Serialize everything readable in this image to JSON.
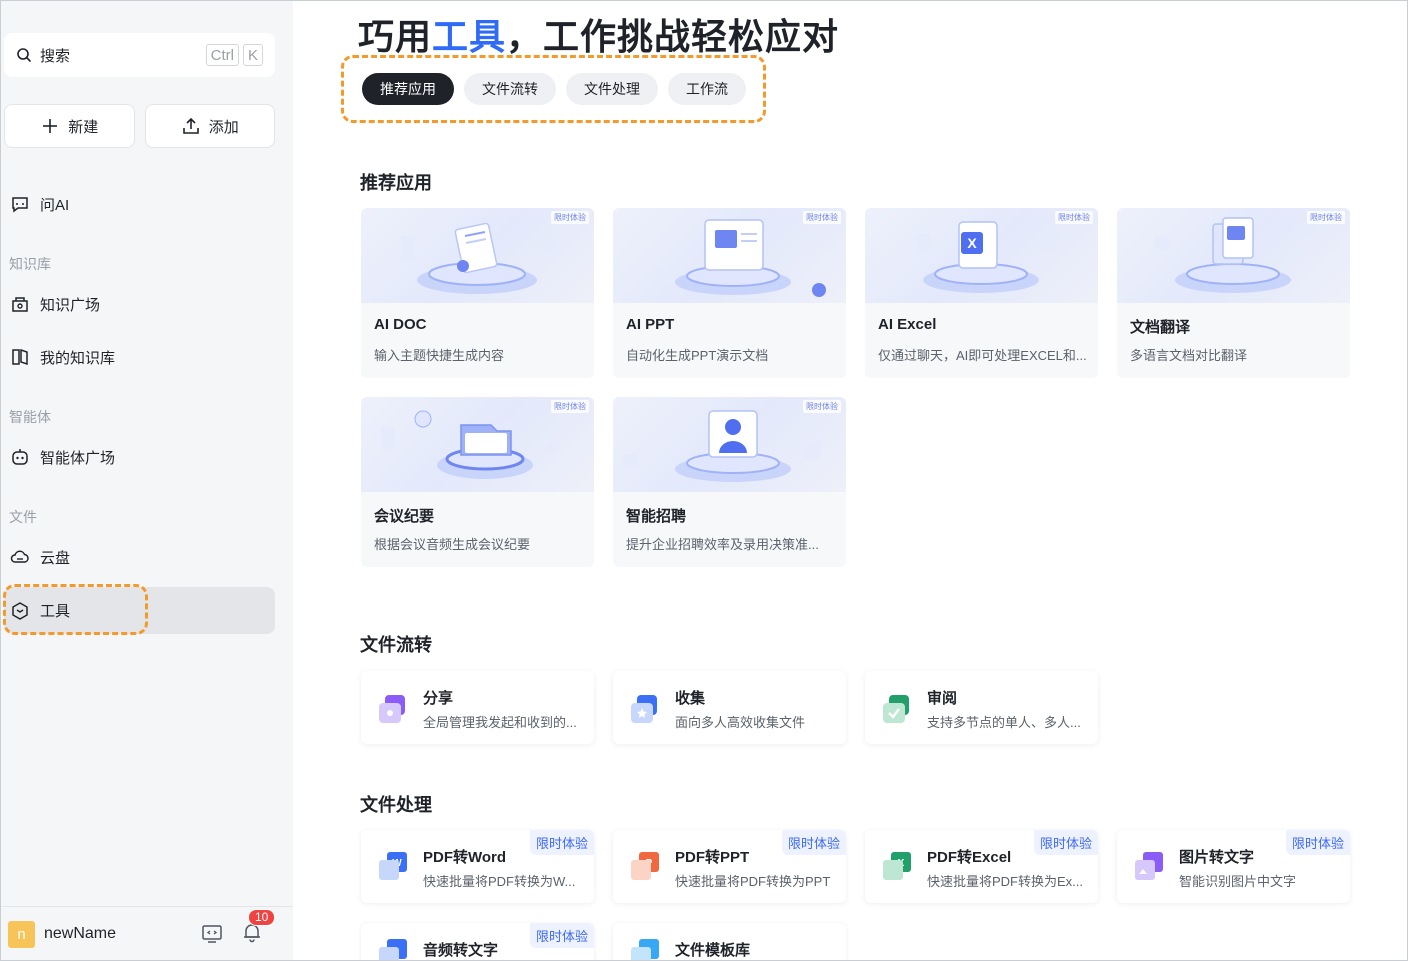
{
  "sidebar": {
    "search": {
      "label": "搜索",
      "shortcut_mod": "Ctrl",
      "shortcut_key": "K"
    },
    "new_label": "新建",
    "add_label": "添加",
    "ask_ai": "问AI",
    "sections": {
      "knowledge": "知识库",
      "agents": "智能体",
      "files": "文件"
    },
    "items": {
      "knowledge_square": "知识广场",
      "my_knowledge": "我的知识库",
      "agent_square": "智能体广场",
      "cloud": "云盘",
      "tools": "工具"
    },
    "user": {
      "avatar_initial": "n",
      "name": "newName",
      "notification_count": "10"
    }
  },
  "main": {
    "headline": {
      "part1": "巧用",
      "highlight": "工具",
      "part2": "，工作挑战轻松应对"
    },
    "tabs": [
      "推荐应用",
      "文件流转",
      "文件处理",
      "工作流"
    ],
    "recommended": {
      "title": "推荐应用",
      "thumb_tag": "限时体验",
      "cards": [
        {
          "title": "AI DOC",
          "desc": "输入主题快捷生成内容"
        },
        {
          "title": "AI PPT",
          "desc": "自动化生成PPT演示文档"
        },
        {
          "title": "AI Excel",
          "desc": "仅通过聊天，AI即可处理EXCEL和..."
        },
        {
          "title": "文档翻译",
          "desc": "多语言文档对比翻译"
        },
        {
          "title": "会议纪要",
          "desc": "根据会议音频生成会议纪要"
        },
        {
          "title": "智能招聘",
          "desc": "提升企业招聘效率及录用决策准..."
        }
      ]
    },
    "flow": {
      "title": "文件流转",
      "cards": [
        {
          "title": "分享",
          "desc": "全局管理我发起和收到的..."
        },
        {
          "title": "收集",
          "desc": "面向多人高效收集文件"
        },
        {
          "title": "审阅",
          "desc": "支持多节点的单人、多人..."
        }
      ]
    },
    "processing": {
      "title": "文件处理",
      "limited_tag": "限时体验",
      "cards": [
        {
          "title": "PDF转Word",
          "desc": "快速批量将PDF转换为W..."
        },
        {
          "title": "PDF转PPT",
          "desc": "快速批量将PDF转换为PPT"
        },
        {
          "title": "PDF转Excel",
          "desc": "快速批量将PDF转换为Ex..."
        },
        {
          "title": "图片转文字",
          "desc": "智能识别图片中文字"
        },
        {
          "title": "音频转文字",
          "desc": ""
        },
        {
          "title": "文件模板库",
          "desc": ""
        }
      ]
    }
  },
  "colors": {
    "accent": "#2f6bf6",
    "highlight_dash": "#f39a2b",
    "sidebar_bg": "#f5f6f8",
    "active_pill": "#1f2329",
    "badge": "#f04443"
  },
  "icons": {
    "search": "search-icon",
    "new": "plus-icon",
    "add": "upload-icon",
    "ask_ai": "chat-ai-icon",
    "knowledge_square": "knowledge-square-icon",
    "my_knowledge": "book-icon",
    "agent_square": "robot-icon",
    "cloud": "cloud-icon",
    "tools": "cube-icon",
    "screen": "screen-share-icon",
    "bell": "bell-icon"
  }
}
